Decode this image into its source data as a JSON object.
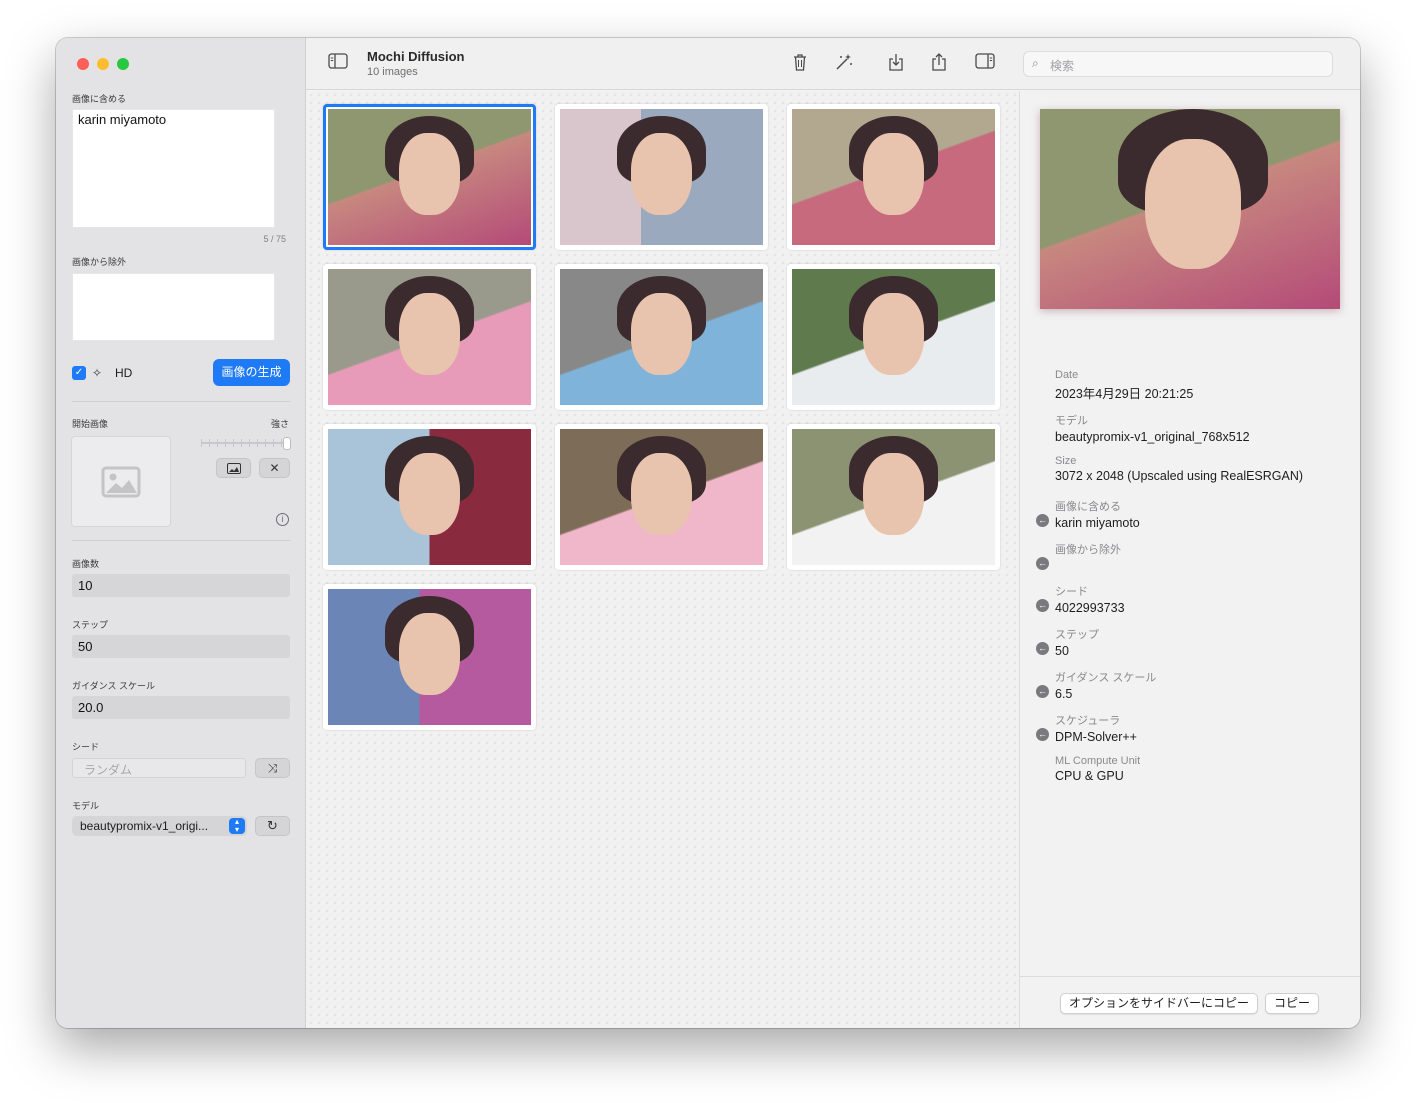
{
  "window": {
    "title": "Mochi Diffusion",
    "subtitle": "10 images"
  },
  "sidebar": {
    "include_label": "画像に含める",
    "include_value": "karin miyamoto",
    "token_count": "5 / 75",
    "exclude_label": "画像から除外",
    "exclude_value": "",
    "hd_checked": true,
    "hd_label": "HD",
    "generate_label": "画像の生成",
    "start_image_label": "開始画像",
    "strength_label": "強さ",
    "image_count_label": "画像数",
    "image_count_value": "10",
    "steps_label": "ステップ",
    "steps_value": "50",
    "guidance_label": "ガイダンス スケール",
    "guidance_value": "20.0",
    "seed_label": "シード",
    "seed_placeholder": "ランダム",
    "model_label": "モデル",
    "model_value": "beautypromix-v1_origi..."
  },
  "toolbar": {
    "search_placeholder": "検索"
  },
  "gallery": {
    "count": 10,
    "selected_index": 0
  },
  "inspector": {
    "fields": [
      {
        "key": "Date",
        "value": "2023年4月29日 20:21:25"
      },
      {
        "key": "モデル",
        "value": "beautypromix-v1_original_768x512"
      },
      {
        "key": "Size",
        "value": "3072 x 2048 (Upscaled using RealESRGAN)"
      },
      {
        "key": "画像に含める",
        "value": "karin miyamoto"
      },
      {
        "key": "画像から除外",
        "value": ""
      },
      {
        "key": "シード",
        "value": "4022993733"
      },
      {
        "key": "ステップ",
        "value": "50"
      },
      {
        "key": "ガイダンス スケール",
        "value": "6.5"
      },
      {
        "key": "スケジューラ",
        "value": "DPM-Solver++"
      },
      {
        "key": "ML Compute Unit",
        "value": "CPU & GPU"
      }
    ],
    "copy_to_sidebar_label": "オプションをサイドバーにコピー",
    "copy_label": "コピー"
  },
  "colors": {
    "accent": "#1f7bf5",
    "close": "#ff5f57",
    "minimize": "#febc2e",
    "zoom": "#28c840"
  }
}
